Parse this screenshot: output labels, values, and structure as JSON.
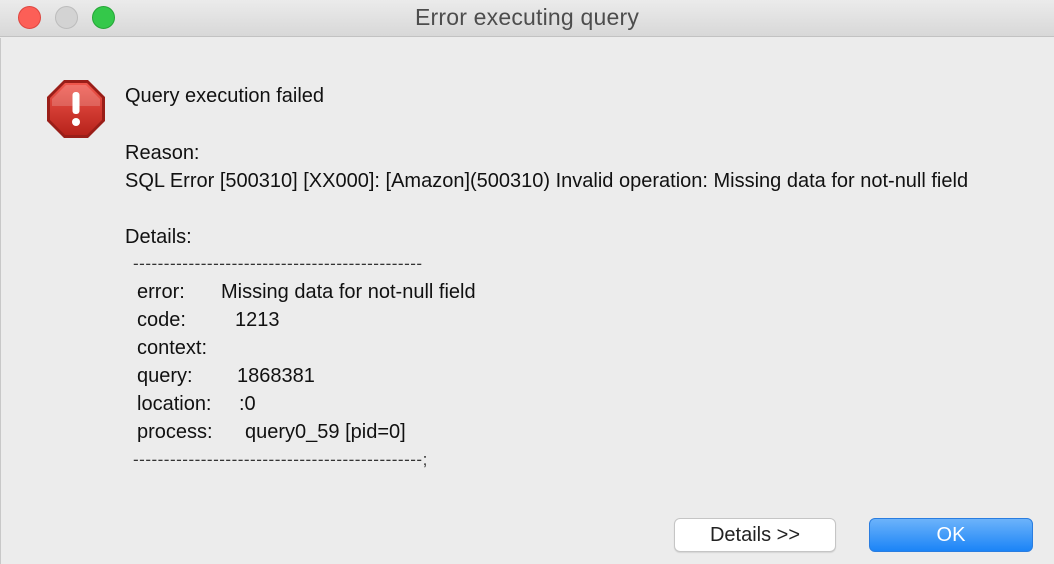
{
  "window": {
    "title": "Error executing query"
  },
  "dialog": {
    "icon": "error-stop-icon",
    "headline": "Query execution failed",
    "reason_label": "Reason:",
    "reason_text": "SQL Error [500310] [XX000]: [Amazon](500310) Invalid operation: Missing data for not-null field",
    "details_label": "Details:",
    "separator_top": "-----------------------------------------------",
    "separator_bottom": "-----------------------------------------------;",
    "details": {
      "error_key": "error:",
      "error_value": "Missing data for not-null field",
      "code_key": "code:",
      "code_value": "1213",
      "context_key": "context:",
      "context_value": "",
      "query_key": "query:",
      "query_value": "1868381",
      "location_key": "location:",
      "location_value": ":0",
      "process_key": "process:",
      "process_value": "query0_59 [pid=0]"
    }
  },
  "buttons": {
    "details_label": "Details >>",
    "ok_label": "OK"
  },
  "colors": {
    "accent": "#1b84f7",
    "error_red": "#d9322b",
    "close": "#fc5f57",
    "zoom": "#34c84a"
  }
}
